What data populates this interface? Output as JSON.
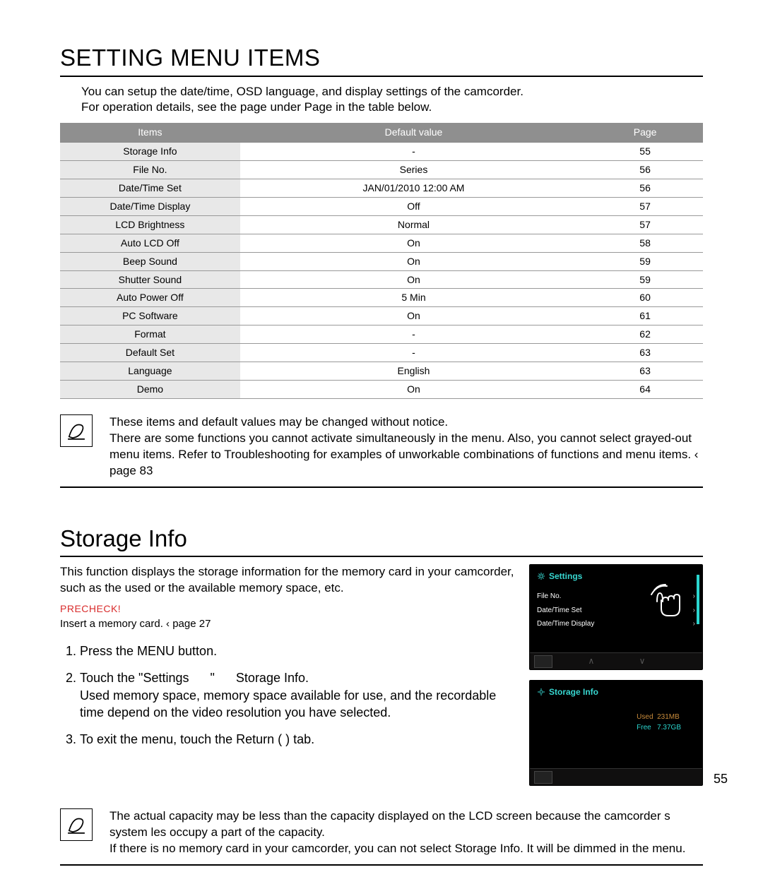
{
  "page_number": "55",
  "heading1": "SETTING MENU ITEMS",
  "intro1": "You can setup the date/time, OSD language, and display settings of the camcorder.",
  "intro2": "For operation details, see the page under Page in the table below.",
  "table": {
    "headers": [
      "Items",
      "Default value",
      "Page"
    ],
    "rows": [
      [
        "Storage Info",
        "-",
        "55"
      ],
      [
        "File No.",
        "Series",
        "56"
      ],
      [
        "Date/Time Set",
        "JAN/01/2010 12:00 AM",
        "56"
      ],
      [
        "Date/Time Display",
        "Off",
        "57"
      ],
      [
        "LCD Brightness",
        "Normal",
        "57"
      ],
      [
        "Auto LCD Off",
        "On",
        "58"
      ],
      [
        "Beep Sound",
        "On",
        "59"
      ],
      [
        "Shutter Sound",
        "On",
        "59"
      ],
      [
        "Auto Power Off",
        "5 Min",
        "60"
      ],
      [
        "PC Software",
        "On",
        "61"
      ],
      [
        "Format",
        "-",
        "62"
      ],
      [
        "Default Set",
        "-",
        "63"
      ],
      [
        "Language",
        "English",
        "63"
      ],
      [
        "Demo",
        "On",
        "64"
      ]
    ]
  },
  "note1_l1": "These items and default values may be changed without notice.",
  "note1_l2": "There are some functions you cannot activate simultaneously in the menu. Also, you cannot select grayed-out menu items. Refer to Troubleshooting for examples of unworkable combinations of functions and menu items. ‹ page 83",
  "heading2": "Storage Info",
  "storage_intro": "This function displays the storage information for the memory card in your camcorder, such as the used or the available memory space, etc.",
  "precheck_label": "PRECHECK!",
  "insert_card": "Insert a memory card. ‹ page 27",
  "steps": {
    "s1": "Press the MENU button.",
    "s2a": "Touch the \"Settings",
    "s2a_mid": "\"",
    "s2a_end": "Storage Info.",
    "s2b": "Used memory space, memory space available for use, and the recordable time depend on the video resolution you have selected.",
    "s3": "To exit the menu, touch the Return (    ) tab."
  },
  "lcd1": {
    "title": "Settings",
    "rows": [
      "File No.",
      "Date/Time Set",
      "Date/Time Display"
    ]
  },
  "lcd2": {
    "title": "Storage Info",
    "used_label": "Used",
    "used_val": "231MB",
    "free_label": "Free",
    "free_val": "7.37GB"
  },
  "note2_l1": "The actual capacity may be less than the capacity displayed on the LCD screen because the camcorder s system   les occupy a part of the capacity.",
  "note2_l2": "If there is no memory card in your camcorder, you can not select Storage Info. It will be dimmed in the menu."
}
